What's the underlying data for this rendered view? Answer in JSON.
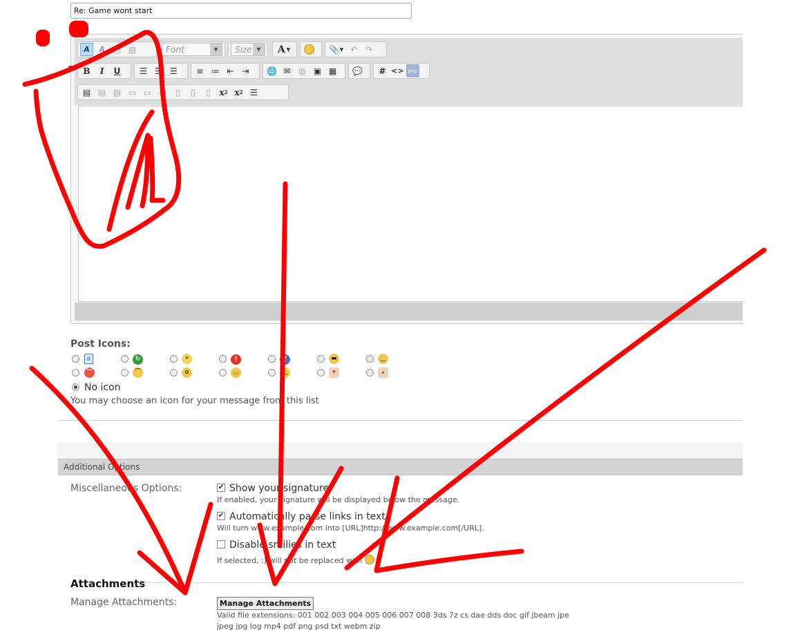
{
  "post": {
    "title_value": "Re: Game wont start"
  },
  "toolbar": {
    "font_placeholder": "Font",
    "size_placeholder": "Size",
    "bold": "B",
    "italic": "I",
    "underline": "U",
    "text_color": "A",
    "hash": "#",
    "code": "<>",
    "php": "php",
    "subscript": "x",
    "superscript": "x"
  },
  "post_icons": {
    "title": "Post Icons:",
    "no_icon_label": "No icon",
    "hint": "You may choose an icon for your message from this list",
    "row1": [
      "document-icon",
      "recycle-icon",
      "lightbulb-icon",
      "exclamation-icon",
      "question-icon",
      "cool-icon",
      "smile-icon"
    ],
    "row2": [
      "angry-icon",
      "frown-icon",
      "redface-icon",
      "biggrin-icon",
      "wink-icon",
      "thumbs-down-icon",
      "thumbs-up-icon"
    ]
  },
  "additional_options": {
    "header": "Additional Options",
    "misc_label": "Miscellaneous Options:",
    "show_signature": {
      "label": "Show your signature",
      "desc": "If enabled, your signature will be displayed below the message.",
      "checked": true
    },
    "parse_links": {
      "label": "Automatically parse links in text",
      "desc": "Will turn www.example.com into [URL]http://www.example.com[/URL].",
      "checked": true
    },
    "disable_smilies": {
      "label": "Disable smilies in text",
      "desc": "If selected, :) will not be replaced with",
      "checked": false
    }
  },
  "attachments": {
    "title": "Attachments",
    "manage_label": "Manage Attachments:",
    "manage_button": "Manage Attachments",
    "valid_extensions": "Valid file extensions: 001 002 003 004 005 006 007 008 3ds 7z cs dae dds doc gif jbeam jpe jpeg jpg log mp4 pdf png psd txt webm zip"
  },
  "colors": {
    "annotation": "#ff0000",
    "toolbar_bg": "#dedede",
    "section_header_bg": "#d4d4d4"
  }
}
